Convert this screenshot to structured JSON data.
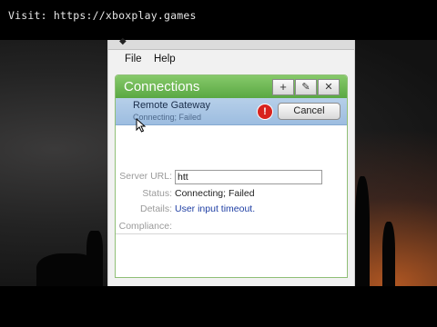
{
  "banner": {
    "text": "Visit: https://xboxplay.games"
  },
  "menu": {
    "file": "File",
    "help": "Help"
  },
  "panel": {
    "title": "Connections",
    "buttons": {
      "add": "+",
      "edit": "✎",
      "close": "✕"
    }
  },
  "connection": {
    "name": "Remote Gateway",
    "status_sub": "Connecting; Failed",
    "alert_glyph": "!",
    "cancel_label": "Cancel"
  },
  "details": {
    "server_url_label": "Server URL:",
    "server_url_value": "htt",
    "status_label": "Status:",
    "status_value": "Connecting; Failed",
    "details_label": "Details:",
    "details_value": "User input timeout.",
    "compliance_label": "Compliance:"
  },
  "colors": {
    "header_green": "#5aa843",
    "row_blue": "#9dbde0",
    "alert_red": "#d8231e",
    "link_blue": "#1f3fa4"
  },
  "icons": {
    "alert": "alert-exclamation-icon",
    "add": "plus-icon",
    "edit": "pencil-icon",
    "close": "close-icon",
    "cursor": "mouse-pointer-icon"
  }
}
